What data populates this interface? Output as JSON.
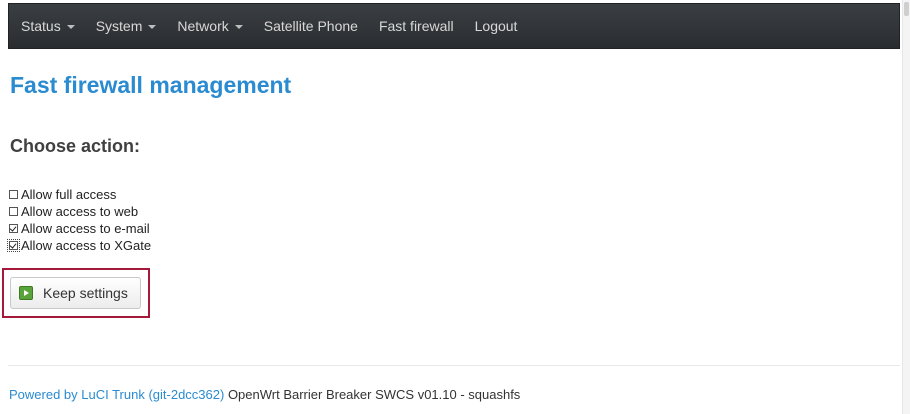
{
  "navbar": {
    "items": [
      {
        "label": "Status",
        "dropdown": true
      },
      {
        "label": "System",
        "dropdown": true
      },
      {
        "label": "Network",
        "dropdown": true
      },
      {
        "label": "Satellite Phone",
        "dropdown": false
      },
      {
        "label": "Fast firewall",
        "dropdown": false
      },
      {
        "label": "Logout",
        "dropdown": false
      }
    ]
  },
  "page": {
    "title": "Fast firewall management",
    "section_title": "Choose action:"
  },
  "options": [
    {
      "label": "Allow full access",
      "checked": false
    },
    {
      "label": "Allow access to web",
      "checked": false
    },
    {
      "label": "Allow access to e-mail",
      "checked": true
    },
    {
      "label": "Allow access to XGate",
      "checked": true
    }
  ],
  "actions": {
    "keep_label": "Keep settings"
  },
  "footer": {
    "link_text": "Powered by LuCI Trunk (git-2dcc362)",
    "text": " OpenWrt Barrier Breaker SWCS v01.10 - squashfs"
  },
  "colors": {
    "accent": "#2a8bd0",
    "navbar": "#2f3336",
    "highlight": "#a4183a",
    "button_icon": "#5aa23a"
  }
}
